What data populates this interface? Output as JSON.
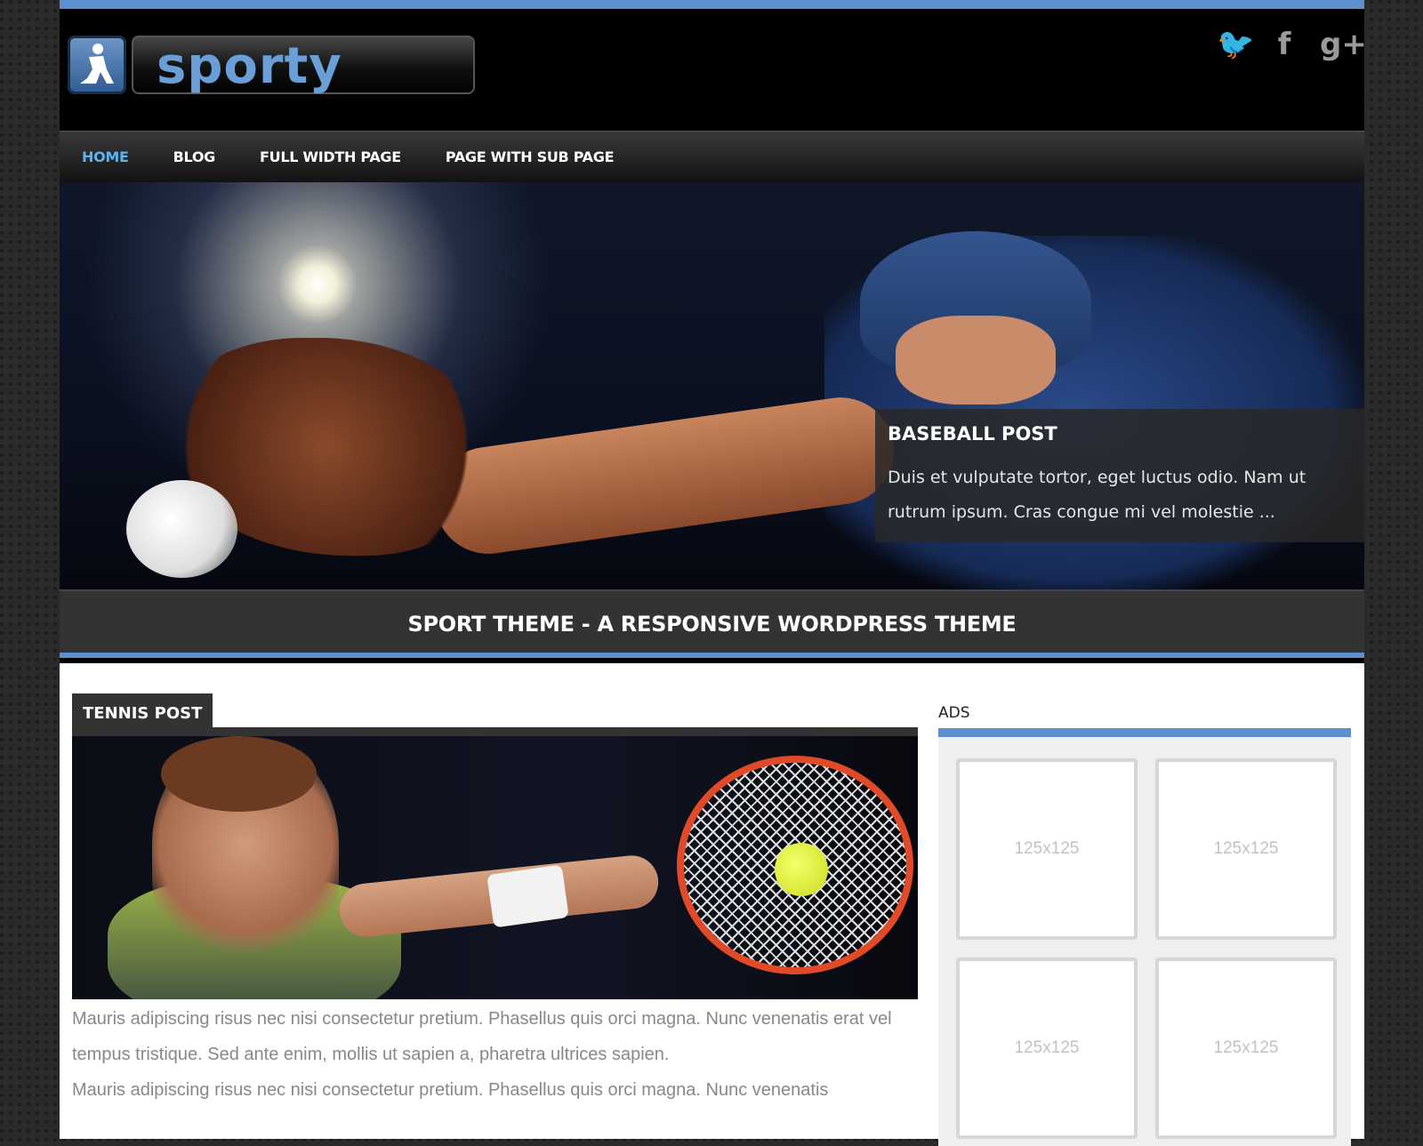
{
  "logo": {
    "text": "sporty"
  },
  "social": {
    "twitter_glyph": "🐦",
    "facebook_glyph": "f",
    "gplus_glyph": "g+"
  },
  "nav": {
    "items": [
      {
        "label": "HOME",
        "active": true
      },
      {
        "label": "BLOG",
        "active": false
      },
      {
        "label": "FULL WIDTH PAGE",
        "active": false
      },
      {
        "label": "PAGE WITH SUB PAGE",
        "active": false
      }
    ]
  },
  "slider": {
    "title": "BASEBALL POST",
    "excerpt": "Duis et vulputate tortor, eget luctus odio. Nam ut rutrum ipsum. Cras congue mi vel molestie  ..."
  },
  "tagline": "SPORT THEME - A RESPONSIVE WORDPRESS THEME",
  "post": {
    "title": "TENNIS POST",
    "paragraphs": [
      "Mauris adipiscing risus nec nisi consectetur pretium. Phasellus quis orci magna. Nunc venenatis erat vel tempus tristique. Sed ante enim, mollis ut sapien a, pharetra ultrices sapien.",
      "Mauris adipiscing risus nec nisi consectetur pretium. Phasellus quis orci magna. Nunc venenatis"
    ]
  },
  "sidebar": {
    "ads_title": "ADS",
    "ads": [
      "125x125",
      "125x125",
      "125x125",
      "125x125"
    ]
  },
  "colors": {
    "accent": "#5d8fce",
    "nav_active": "#5db4ee"
  }
}
